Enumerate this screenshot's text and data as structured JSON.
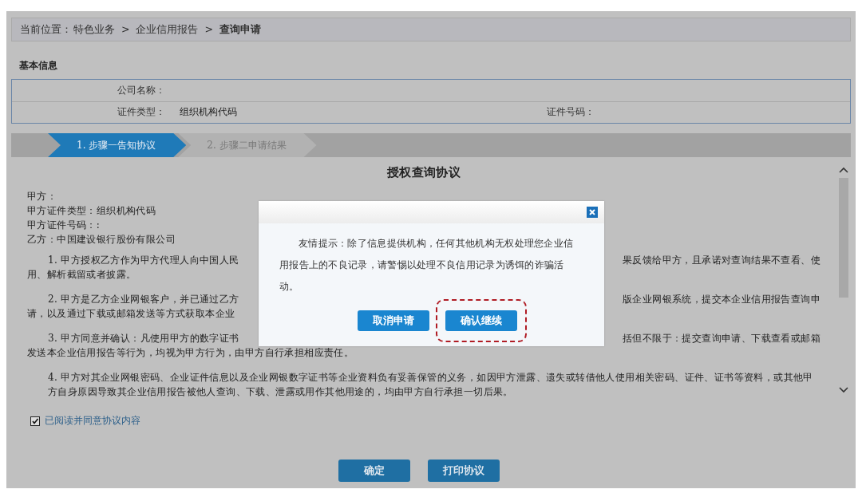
{
  "breadcrumb": {
    "prefix": "当前位置：",
    "items": [
      {
        "label": "特色业务",
        "current": false
      },
      {
        "label": "企业信用报告",
        "current": false
      },
      {
        "label": "查询申请",
        "current": true
      }
    ],
    "separator": ">"
  },
  "section_title": "基本信息",
  "info": {
    "company_label": "公司名称：",
    "id_type_label": "证件类型：",
    "id_type_value": "组织机构代码",
    "id_number_label": "证件号码："
  },
  "steps": [
    {
      "label": "1. 步骤一告知协议",
      "selected": true
    },
    {
      "label": "2. 步骤二申请结果",
      "selected": false
    }
  ],
  "agreement": {
    "title": "授权查询协议",
    "parties": [
      "甲方：",
      "甲方证件类型：组织机构代码",
      "甲方证件号码：:",
      "乙方：中国建设银行股份有限公司"
    ],
    "paragraphs": [
      {
        "first_left": "1. 甲方授权乙方作为甲方代理人向中国人民",
        "first_right": "果反馈给甲方，且承诺对查询结果不查看、使",
        "rest": "用、解析截留或者披露。"
      },
      {
        "first_left": "2. 甲方是乙方企业网银客户，并已通过乙方",
        "first_right": "版企业网银系统，提交本企业信用报告查询申",
        "rest_left": "请，以及通过下载或邮箱发送等方式获取本企业"
      },
      {
        "first_left": "3.  甲方同意并确认：凡使用甲方的数字证书",
        "first_right": "括但不限于：提交查询申请、下载查看或邮箱",
        "rest": "发送本企业信用报告等行为，均视为甲方行为，由甲方自行承担相应责任。"
      },
      {
        "text": "4. 甲方对其企业网银密码、企业证件信息以及企业网银数字证书等企业资料负有妥善保管的义务，如因甲方泄露、遗失或转借他人使用相关密码、证件、证书等资料，或其他甲方自身原因导致其企业信用报告被他人查询、下载、泄露或用作其他用途的，均由甲方自行承担一切后果。"
      }
    ]
  },
  "agree": {
    "label": "已阅读并同意协议内容",
    "checked": true
  },
  "buttons": [
    "确定",
    "打印协议"
  ],
  "dialog": {
    "message": "友情提示：除了信息提供机构，任何其他机构无权处理您企业信用报告上的不良记录，请警惕以处理不良信用记录为诱饵的诈骗活动。",
    "buttons": [
      {
        "label": "取消申请",
        "highlighted": false
      },
      {
        "label": "确认继续",
        "highlighted": true
      }
    ]
  }
}
